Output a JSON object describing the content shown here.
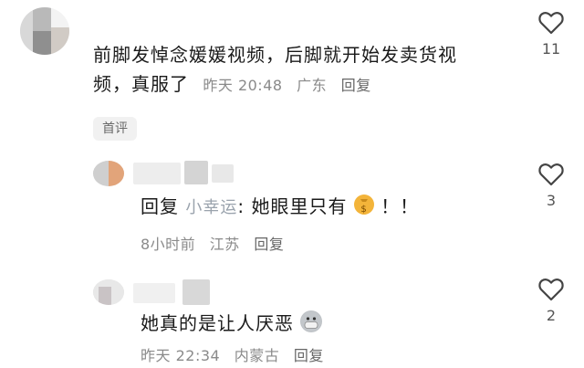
{
  "comments": [
    {
      "text_line1": "前脚发悼念媛媛视频，后脚就开始发卖货视",
      "text_line2": "频，真服了",
      "time": "昨天 20:48",
      "location": "广东",
      "reply_label": "回复",
      "like_count": "11",
      "badge": "首评"
    },
    {
      "reply_prefix": "回复",
      "reply_target": "小幸运",
      "text": "她眼里只有",
      "text_suffix": "！！",
      "emoji": "money-bag-icon",
      "time": "8小时前",
      "location": "江苏",
      "reply_label": "回复",
      "like_count": "3"
    },
    {
      "text": "她真的是让人厌恶",
      "emoji": "mask-face-icon",
      "time": "昨天 22:34",
      "location": "内蒙古",
      "reply_label": "回复",
      "like_count": "2"
    }
  ],
  "colors": {
    "text": "#1a1a1a",
    "meta": "#8a8a8a",
    "reply_target": "#9aa3ad",
    "badge_bg": "#f1f1f1"
  }
}
